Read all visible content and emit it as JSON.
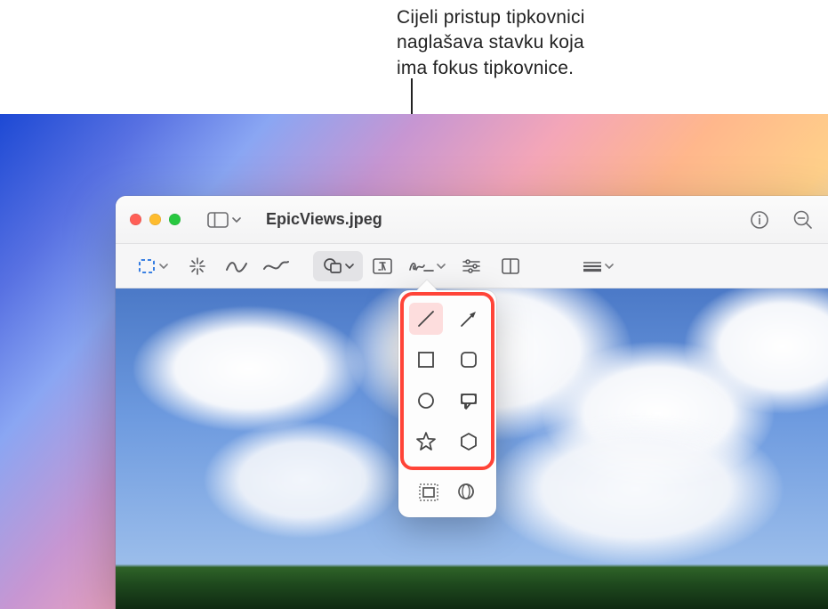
{
  "callout": {
    "line1": "Cijeli pristup tipkovnici",
    "line2": "naglašava stavku koja",
    "line3": "ima fokus tipkovnice."
  },
  "window": {
    "title": "EpicViews.jpeg",
    "traffic": {
      "close": "close",
      "min": "minimize",
      "max": "maximize"
    },
    "sidebar_toggle": "sidebar-toggle",
    "info": "info",
    "zoom_out": "zoom-out"
  },
  "toolbar": {
    "select": "select-tool",
    "instant_alpha": "instant-alpha-tool",
    "draw": "draw-tool",
    "sketch": "sketch-tool",
    "shapes": "shapes-tool",
    "text": "text-tool",
    "sign": "sign-tool",
    "adjust": "adjust-color-tool",
    "crop": "crop-tool",
    "more": "line-style-tool"
  },
  "shapes_popover": {
    "items": [
      {
        "name": "line-shape",
        "selected": true
      },
      {
        "name": "arrow-shape",
        "selected": false
      },
      {
        "name": "square-shape",
        "selected": false
      },
      {
        "name": "rounded-square-shape",
        "selected": false
      },
      {
        "name": "circle-shape",
        "selected": false
      },
      {
        "name": "speech-bubble-shape",
        "selected": false
      },
      {
        "name": "star-shape",
        "selected": false
      },
      {
        "name": "hexagon-shape",
        "selected": false
      }
    ],
    "footer": {
      "mask": "mask-tool",
      "loupe": "loupe-tool"
    }
  },
  "colors": {
    "focus_ring": "#ff4438",
    "toolbar_icon": "#555555",
    "select_outline": "#1f6fe0"
  }
}
